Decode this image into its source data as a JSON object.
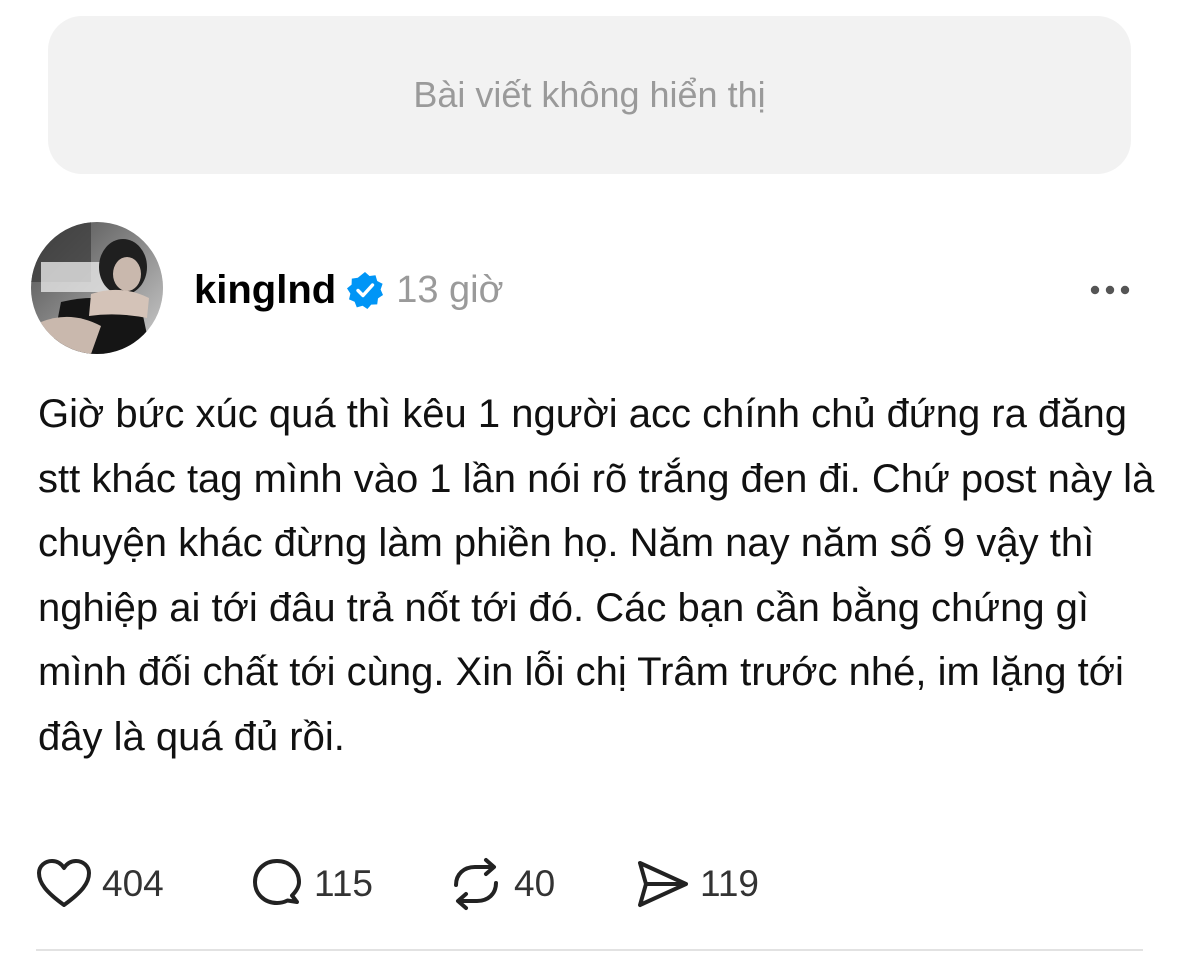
{
  "hidden_post": {
    "text": "Bài viết không hiển thị"
  },
  "post": {
    "username": "kinglnd",
    "verified": true,
    "timestamp": "13 giờ",
    "more_icon": "more-horizontal-icon",
    "text": "Giờ bức xúc quá thì kêu 1 người acc chính chủ đứng ra đăng stt khác tag mình vào 1 lần nói rõ trắng đen đi. Chứ post này là chuyện khác đừng làm phiền họ. Năm nay năm số 9 vậy thì nghiệp ai tới đâu trả nốt tới đó. Các bạn cần bằng chứng gì mình đối chất tới cùng. Xin lỗi chị Trâm trước nhé, im lặng tới đây là quá đủ rồi.",
    "actions": {
      "likes": "404",
      "comments": "115",
      "reposts": "40",
      "shares": "119"
    }
  },
  "colors": {
    "verified_blue": "#0095f6",
    "muted_text": "#9a9a9a",
    "hidden_bg": "#f2f2f2"
  }
}
